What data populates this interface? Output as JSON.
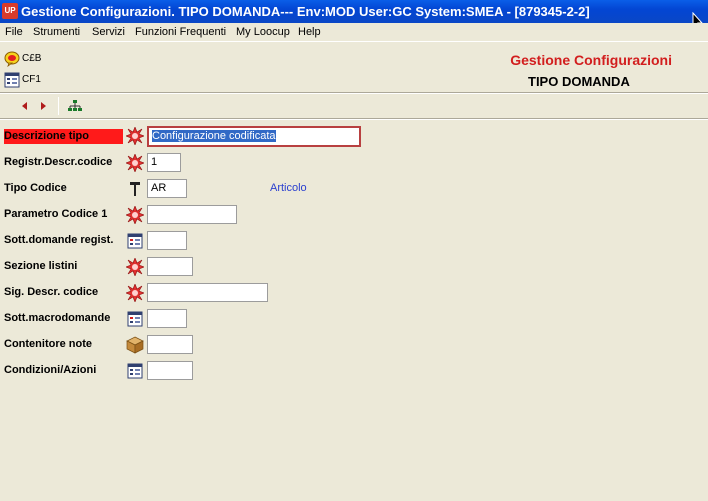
{
  "window": {
    "app_icon_text": "UP",
    "title": "Gestione Configurazioni. TIPO DOMANDA--- Env:MOD User:GC System:SMEA - [879345-2-2]"
  },
  "menu": [
    "File",
    "Strumenti",
    "Servizi",
    "Funzioni Frequenti",
    "My Loocup",
    "Help"
  ],
  "header": {
    "rows": [
      {
        "icon": "help-bubble-icon",
        "label": "C£B"
      },
      {
        "icon": "form-list-icon",
        "label": "CF1"
      }
    ],
    "title": "Gestione Configurazioni",
    "subtitle": "TIPO DOMANDA"
  },
  "toolbar": {
    "buttons": [
      "previous-arrow-icon",
      "next-arrow-icon",
      "tree-structure-icon"
    ]
  },
  "form": {
    "fields": [
      {
        "label": "Descrizione tipo",
        "icon": "required-burst-icon",
        "value": "Configurazione codificata",
        "required": true,
        "focused": true,
        "desc": ""
      },
      {
        "label": "Registr.Descr.codice",
        "icon": "required-burst-icon",
        "value": "1",
        "desc": ""
      },
      {
        "label": "Tipo Codice",
        "icon": "pin-icon",
        "value": "AR",
        "desc": "Articolo"
      },
      {
        "label": "Parametro Codice 1",
        "icon": "required-burst-icon",
        "value": "",
        "desc": ""
      },
      {
        "label": "Sott.domande regist.",
        "icon": "form-list-icon",
        "value": "",
        "desc": ""
      },
      {
        "label": "Sezione listini",
        "icon": "required-burst-icon",
        "value": "",
        "desc": ""
      },
      {
        "label": "Sig. Descr. codice",
        "icon": "required-burst-icon",
        "value": "",
        "desc": ""
      },
      {
        "label": "Sott.macrodomande",
        "icon": "form-list-icon",
        "value": "",
        "desc": ""
      },
      {
        "label": "Contenitore note",
        "icon": "package-icon",
        "value": "",
        "desc": ""
      },
      {
        "label": "Condizioni/Azioni",
        "icon": "form-list-icon",
        "value": "",
        "desc": ""
      }
    ]
  },
  "colors": {
    "title_bar": "#0a47c6",
    "brand_red": "#d21e1e",
    "required_label_bg": "#ff1a1a",
    "desc_blue": "#2a3fcf",
    "background": "#ece9d8"
  }
}
